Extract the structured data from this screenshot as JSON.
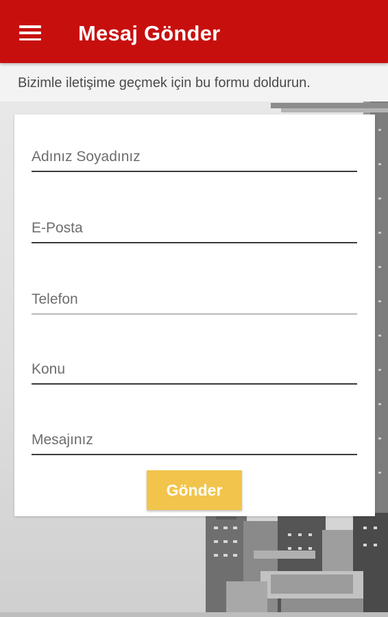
{
  "appbar": {
    "title": "Mesaj Gönder",
    "menu_icon": "menu-icon",
    "color": "#c70f0e"
  },
  "subtitle": "Bizimle iletişime geçmek için bu formu doldurun.",
  "form": {
    "fields": [
      {
        "placeholder": "Adınız Soyadınız",
        "value": ""
      },
      {
        "placeholder": "E-Posta",
        "value": ""
      },
      {
        "placeholder": "Telefon",
        "value": ""
      },
      {
        "placeholder": "Konu",
        "value": ""
      },
      {
        "placeholder": "Mesajınız",
        "value": ""
      }
    ],
    "submit_label": "Gönder",
    "submit_color": "#f2c44c"
  }
}
